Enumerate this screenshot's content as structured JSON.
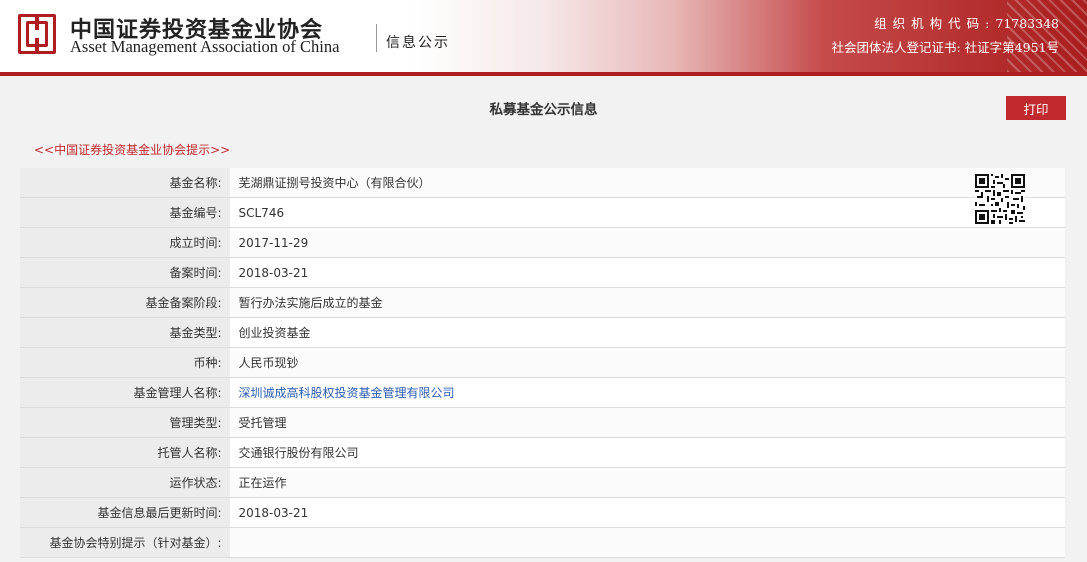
{
  "header": {
    "org_name_cn": "中国证券投资基金业协会",
    "org_name_en": "Asset Management Association of China",
    "subtitle": "信息公示",
    "org_code_label": "组织机构代码:",
    "org_code": "71783348",
    "license_line": "社会团体法人登记证书: 社证字第4951号",
    "brand_color": "#b01d21"
  },
  "page": {
    "title": "私募基金公示信息",
    "print_label": "打印",
    "tip_link": "<<中国证券投资基金业协会提示>>"
  },
  "fields": [
    {
      "label": "基金名称:",
      "value": "芜湖鼎证捌号投资中心（有限合伙）"
    },
    {
      "label": "基金编号:",
      "value": "SCL746"
    },
    {
      "label": "成立时间:",
      "value": "2017-11-29"
    },
    {
      "label": "备案时间:",
      "value": "2018-03-21"
    },
    {
      "label": "基金备案阶段:",
      "value": "暂行办法实施后成立的基金"
    },
    {
      "label": "基金类型:",
      "value": "创业投资基金"
    },
    {
      "label": "币种:",
      "value": "人民币现钞"
    },
    {
      "label": "基金管理人名称:",
      "value": "深圳诚成高科股权投资基金管理有限公司"
    },
    {
      "label": "管理类型:",
      "value": "受托管理"
    },
    {
      "label": "托管人名称:",
      "value": "交通银行股份有限公司"
    },
    {
      "label": "运作状态:",
      "value": "正在运作"
    },
    {
      "label": "基金信息最后更新时间:",
      "value": "2018-03-21"
    },
    {
      "label": "基金协会特别提示（针对基金）:",
      "value": ""
    }
  ],
  "icons": {
    "logo": "aamc-logo-icon",
    "qr": "qr-code-icon"
  }
}
